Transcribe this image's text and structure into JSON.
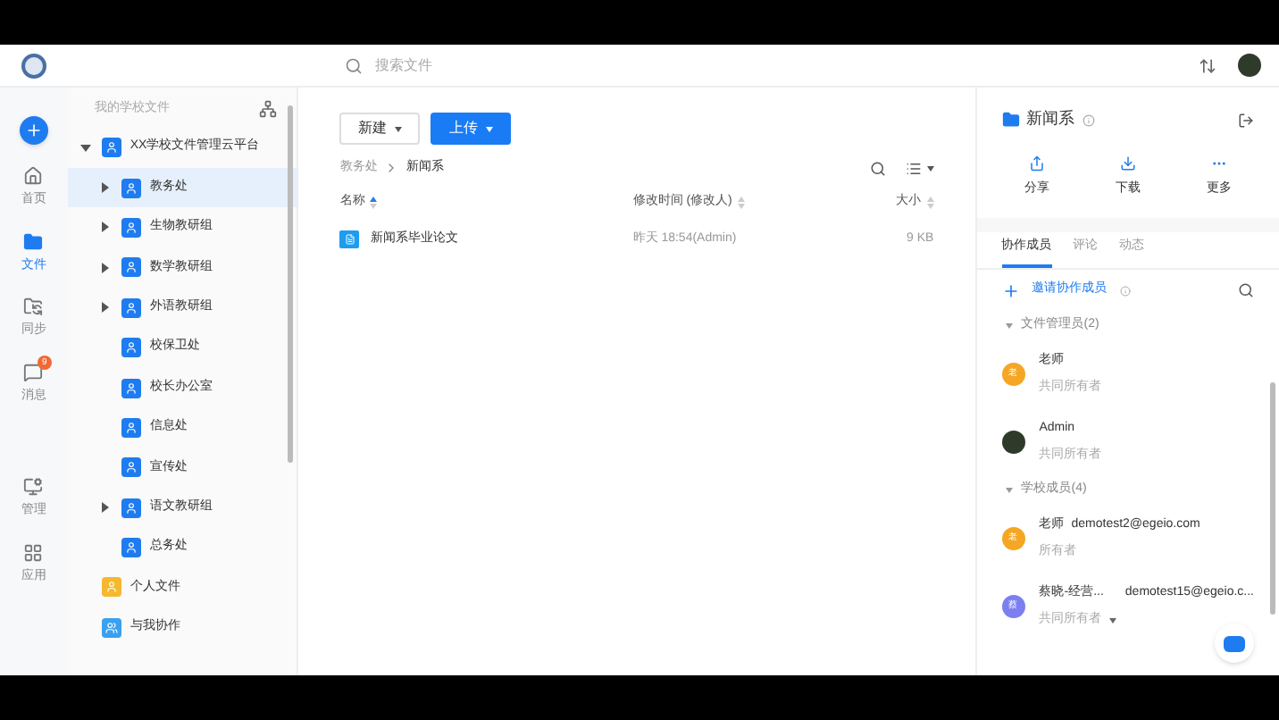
{
  "header": {
    "search_placeholder": "搜索文件"
  },
  "rail": [
    {
      "label": "首页",
      "selected": false
    },
    {
      "label": "文件",
      "selected": true
    },
    {
      "label": "同步",
      "selected": false
    },
    {
      "label": "消息",
      "selected": false,
      "badge": "9"
    },
    {
      "label": "管理",
      "selected": false
    },
    {
      "label": "应用",
      "selected": false
    }
  ],
  "tree": {
    "title": "我的学校文件",
    "items": [
      {
        "label": "XX学校文件管理云平台",
        "kind": "school",
        "expanded": true,
        "selected": false,
        "children": [
          {
            "label": "教务处",
            "kind": "dept",
            "has_children": true,
            "selected": true
          },
          {
            "label": "生物教研组",
            "kind": "dept",
            "has_children": true,
            "selected": false
          },
          {
            "label": "数学教研组",
            "kind": "dept",
            "has_children": true,
            "selected": false
          },
          {
            "label": "外语教研组",
            "kind": "dept",
            "has_children": true,
            "selected": false
          },
          {
            "label": "校保卫处",
            "kind": "dept",
            "has_children": false,
            "selected": false
          },
          {
            "label": "校长办公室",
            "kind": "dept",
            "has_children": false,
            "selected": false
          },
          {
            "label": "信息处",
            "kind": "dept",
            "has_children": false,
            "selected": false
          },
          {
            "label": "宣传处",
            "kind": "dept",
            "has_children": false,
            "selected": false
          },
          {
            "label": "语文教研组",
            "kind": "dept",
            "has_children": true,
            "selected": false
          },
          {
            "label": "总务处",
            "kind": "dept",
            "has_children": false,
            "selected": false
          }
        ]
      },
      {
        "label": "个人文件",
        "kind": "personal",
        "expanded": false,
        "selected": false
      },
      {
        "label": "与我协作",
        "kind": "shared",
        "expanded": false,
        "selected": false
      }
    ]
  },
  "toolbar": {
    "new_button": "新建",
    "upload_button": "上传"
  },
  "breadcrumb": [
    "教务处",
    "新闻系"
  ],
  "table": {
    "columns": [
      "名称",
      "修改时间 (修改人)",
      "大小"
    ],
    "rows": [
      {
        "name": "新闻系毕业论文",
        "modified": "昨天 18:54(Admin)",
        "size": "9 KB"
      }
    ]
  },
  "panel": {
    "title": "新闻系",
    "actions": [
      {
        "label": "分享"
      },
      {
        "label": "下载"
      },
      {
        "label": "更多"
      }
    ],
    "tabs": [
      {
        "label": "协作成员",
        "selected": true
      },
      {
        "label": "评论",
        "selected": false
      },
      {
        "label": "动态",
        "selected": false
      }
    ],
    "invite": "邀请协作成员",
    "groups": [
      {
        "title": "文件管理员(2)",
        "members": [
          {
            "name": "老师",
            "role": "共同所有者",
            "avatar": "老",
            "kind": "letter",
            "color": "#f5a623",
            "role_menu": false
          },
          {
            "name": "Admin",
            "role": "共同所有者",
            "kind": "photo",
            "color": "#2e3a2a",
            "role_menu": false
          }
        ]
      },
      {
        "title": "学校成员(4)",
        "members": [
          {
            "name": "老师",
            "email": "demotest2@egeio.com",
            "role": "所有者",
            "avatar": "老",
            "kind": "letter",
            "color": "#f5a623",
            "role_menu": false
          },
          {
            "name": "蔡晓-经营...",
            "email": "demotest15@egeio.c...",
            "role": "共同所有者",
            "avatar": "蔡",
            "kind": "letter",
            "color": "#7b7ff0",
            "role_menu": true
          }
        ]
      }
    ]
  }
}
